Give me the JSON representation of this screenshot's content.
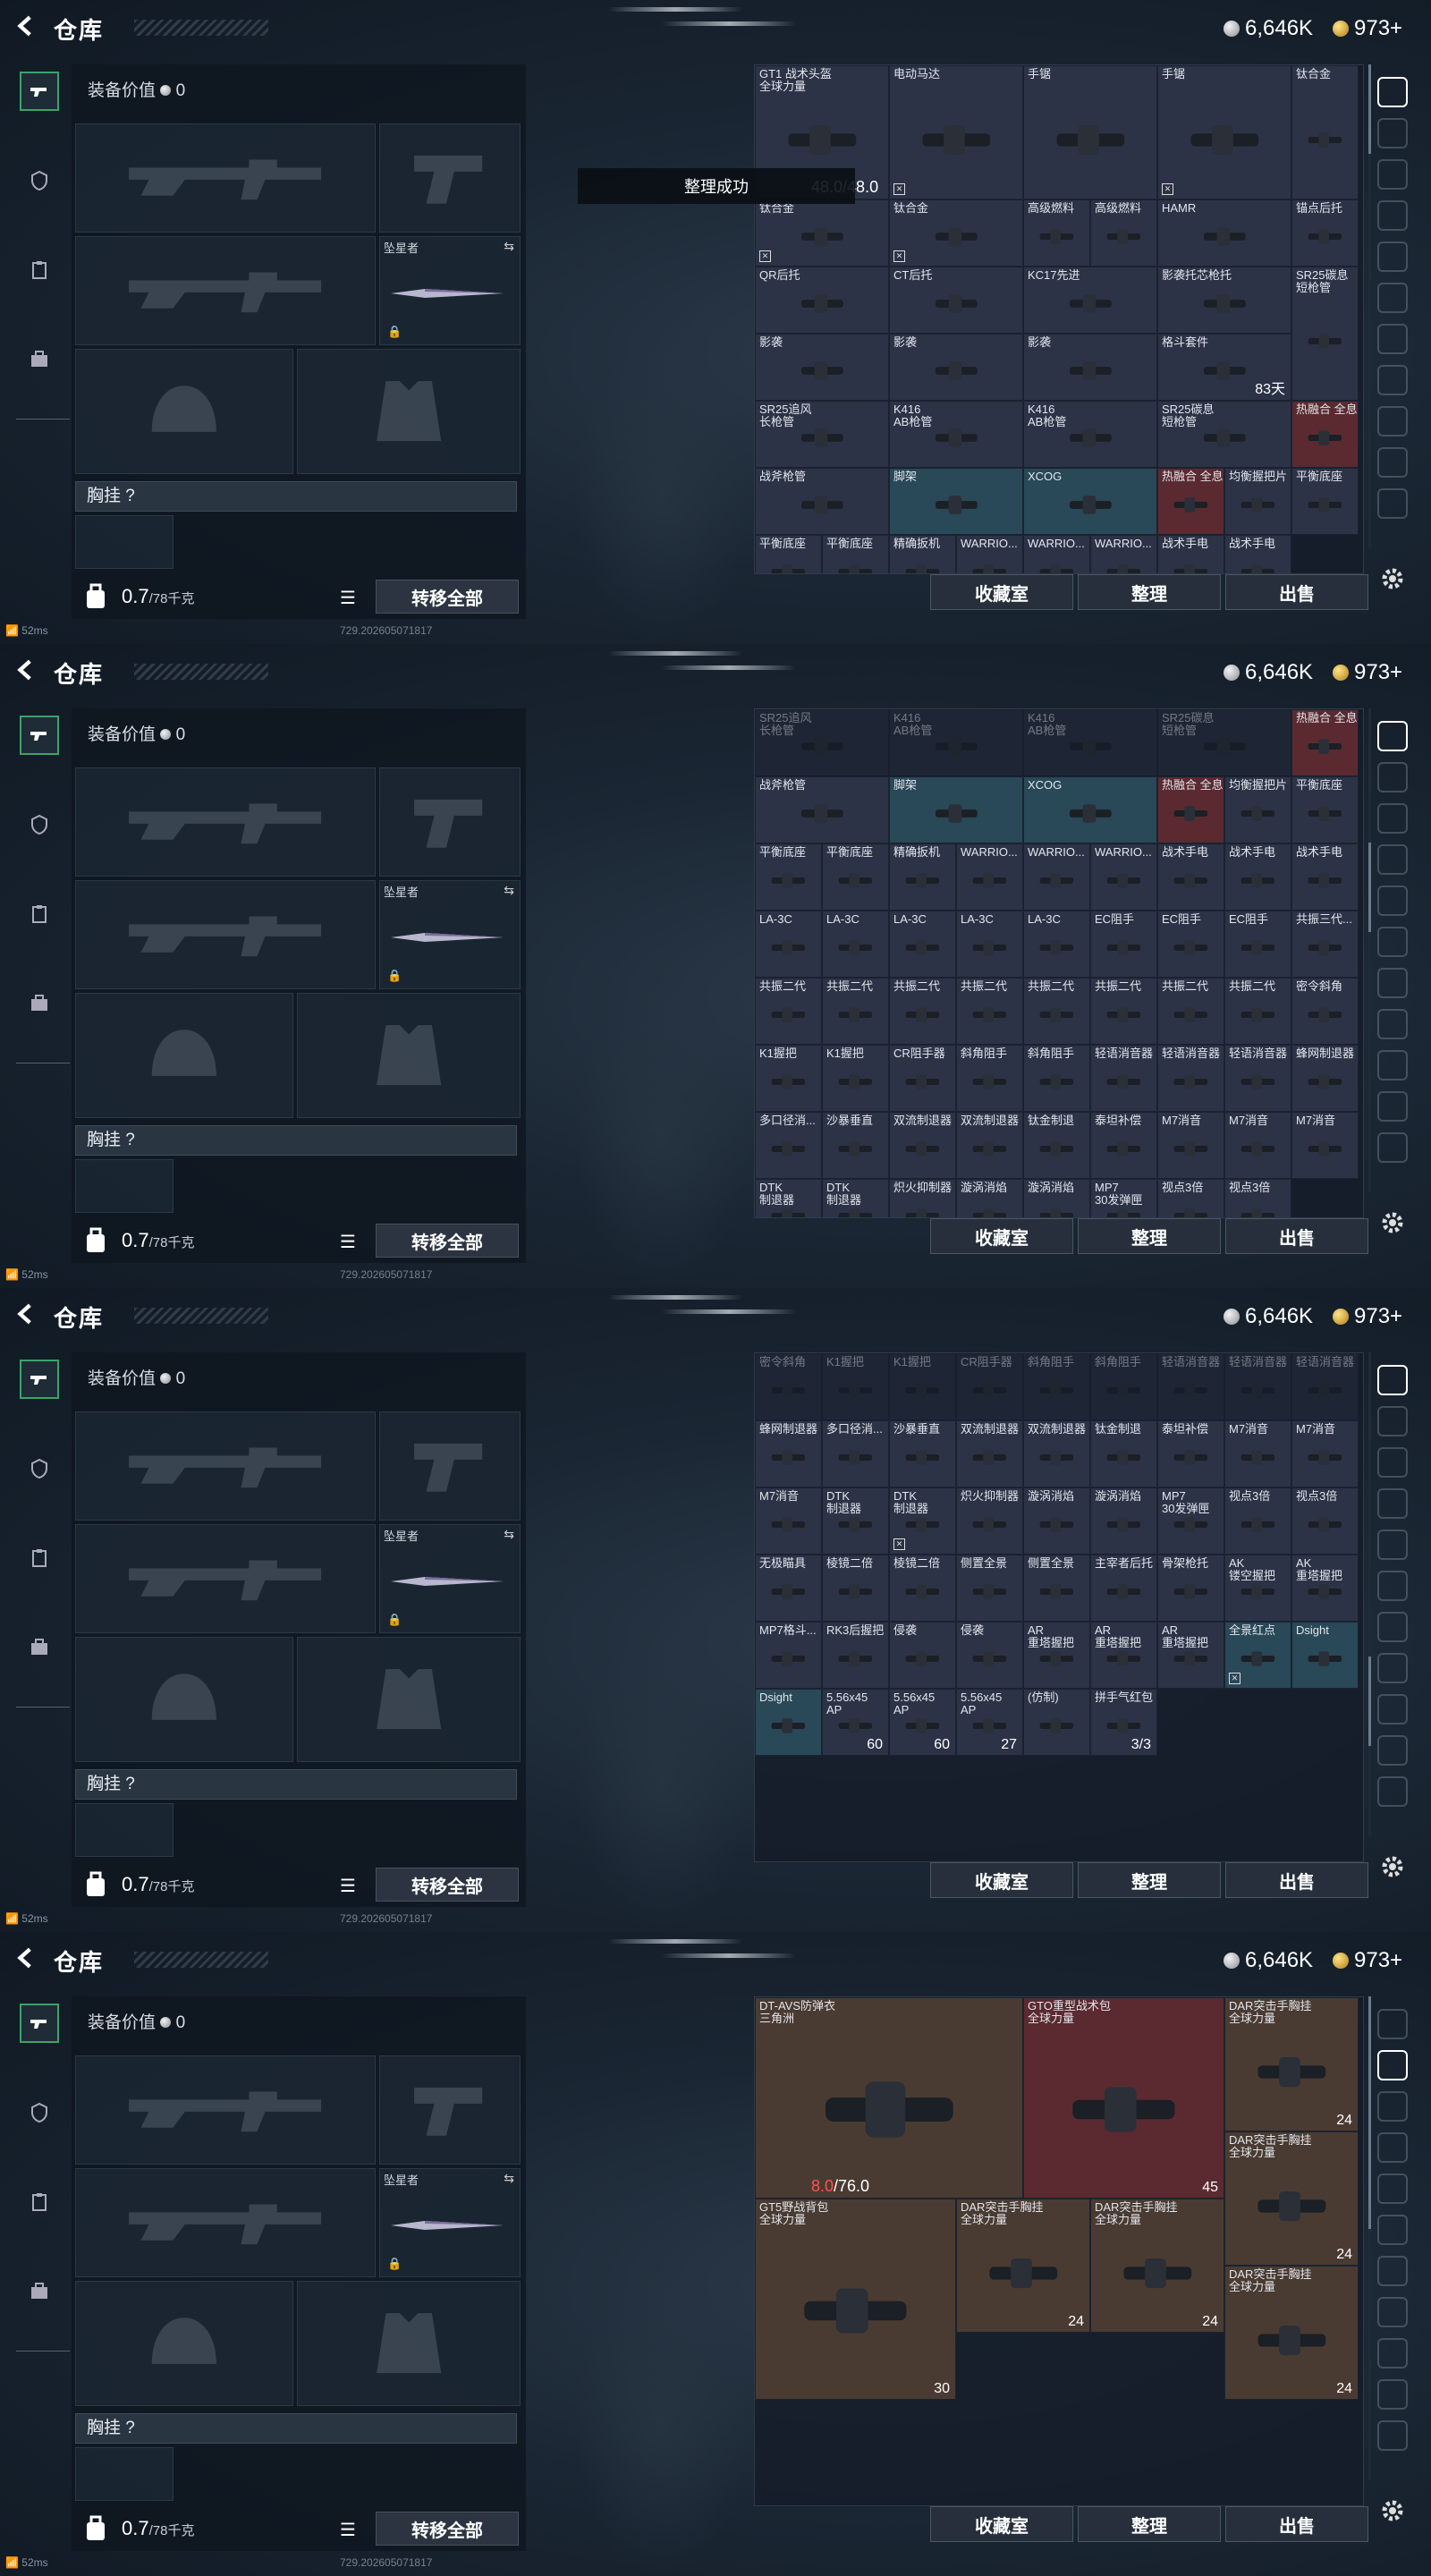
{
  "page": {
    "title": "仓库",
    "currency_silver": "6,646K",
    "currency_gold": "973+",
    "equip_value_label": "装备价值",
    "equip_value": "0",
    "knife_label": "坠星者",
    "chest_label": "胸挂 ?",
    "weight_value": "0.7",
    "weight_max": "/78千克",
    "transfer_all": "转移全部",
    "btn_collection": "收藏室",
    "btn_sort": "整理",
    "btn_sell": "出售",
    "ping": "52ms",
    "build_id": "729.202605071817",
    "toast": "整理成功"
  },
  "screens": [
    {
      "items": [
        {
          "name": "GT1 战术头盔\n全球力量",
          "w": 2,
          "h": 2,
          "dur": "48.0",
          "durmax": "/48.0"
        },
        {
          "name": "电动马达",
          "w": 2,
          "h": 2,
          "mark": 1
        },
        {
          "name": "手锯",
          "w": 2,
          "h": 2
        },
        {
          "name": "手锯",
          "w": 2,
          "h": 2,
          "mark": 1
        },
        {
          "name": "钛合金",
          "w": 1,
          "h": 2
        },
        {
          "name": "钛合金",
          "w": 2,
          "h": 1,
          "mark": 1
        },
        {
          "name": "钛合金",
          "w": 2,
          "h": 1,
          "mark": 1
        },
        {
          "name": "高级燃料"
        },
        {
          "name": "高级燃料"
        },
        {
          "name": "HAMR",
          "w": 2
        },
        {
          "name": "锚点后托"
        },
        {
          "name": "QR后托",
          "w": 2
        },
        {
          "name": "CT后托",
          "w": 2
        },
        {
          "name": "KC17先进",
          "w": 2
        },
        {
          "name": "影袭托芯枪托",
          "w": 2
        },
        {
          "name": "影袭",
          "w": 2
        },
        {
          "name": "影袭",
          "w": 2
        },
        {
          "name": "影袭",
          "w": 2
        },
        {
          "name": "格斗套件",
          "w": 2,
          "cnt": "83天"
        },
        {
          "name": "SR25碳息\n短枪管",
          "h": 2
        },
        {
          "name": "SR25追风\n长枪管",
          "w": 2
        },
        {
          "name": "K416\nAB枪管",
          "w": 2
        },
        {
          "name": "K416\nAB枪管",
          "w": 2
        },
        {
          "name": "SR25碳息\n短枪管",
          "w": 2
        },
        {
          "name": "战斧枪管",
          "w": 2
        },
        {
          "name": "脚架",
          "w": 2,
          "c": "blue"
        },
        {
          "name": "XCOG",
          "w": 2,
          "c": "blue"
        },
        {
          "name": "热融合 全息",
          "c": "red"
        },
        {
          "name": "热融合 全息",
          "c": "red"
        },
        {
          "name": "均衡握把片"
        },
        {
          "name": "平衡底座"
        },
        {
          "name": "平衡底座"
        },
        {
          "name": "平衡底座"
        },
        {
          "name": "精确扳机"
        },
        {
          "name": "WARRIO..."
        },
        {
          "name": "WARRIO..."
        },
        {
          "name": "WARRIO..."
        },
        {
          "name": "战术手电"
        },
        {
          "name": "战术手电"
        }
      ]
    },
    {
      "items": [
        {
          "name": "SR25追风\n长枪管",
          "w": 2,
          "f": 1
        },
        {
          "name": "K416\nAB枪管",
          "w": 2,
          "f": 1
        },
        {
          "name": "K416\nAB枪管",
          "w": 2,
          "f": 1
        },
        {
          "name": "SR25碳息\n短枪管",
          "w": 2,
          "f": 1
        },
        {
          "name": "战斧枪管",
          "w": 2
        },
        {
          "name": "脚架",
          "w": 2,
          "c": "blue"
        },
        {
          "name": "XCOG",
          "w": 2,
          "c": "blue"
        },
        {
          "name": "热融合 全息",
          "c": "red"
        },
        {
          "name": "热融合 全息",
          "c": "red"
        },
        {
          "name": "均衡握把片"
        },
        {
          "name": "平衡底座"
        },
        {
          "name": "平衡底座"
        },
        {
          "name": "平衡底座"
        },
        {
          "name": "精确扳机"
        },
        {
          "name": "WARRIO..."
        },
        {
          "name": "WARRIO..."
        },
        {
          "name": "WARRIO..."
        },
        {
          "name": "战术手电"
        },
        {
          "name": "战术手电"
        },
        {
          "name": "战术手电"
        },
        {
          "name": "LA-3C"
        },
        {
          "name": "LA-3C"
        },
        {
          "name": "LA-3C"
        },
        {
          "name": "LA-3C"
        },
        {
          "name": "LA-3C"
        },
        {
          "name": "EC阻手"
        },
        {
          "name": "EC阻手"
        },
        {
          "name": "EC阻手"
        },
        {
          "name": "共振三代..."
        },
        {
          "name": "共振二代"
        },
        {
          "name": "共振二代"
        },
        {
          "name": "共振二代"
        },
        {
          "name": "共振二代"
        },
        {
          "name": "共振二代"
        },
        {
          "name": "共振二代"
        },
        {
          "name": "共振二代"
        },
        {
          "name": "共振二代"
        },
        {
          "name": "密令斜角"
        },
        {
          "name": "K1握把"
        },
        {
          "name": "K1握把"
        },
        {
          "name": "CR阻手器"
        },
        {
          "name": "斜角阻手"
        },
        {
          "name": "斜角阻手"
        },
        {
          "name": "轻语消音器"
        },
        {
          "name": "轻语消音器"
        },
        {
          "name": "轻语消音器"
        },
        {
          "name": "蜂网制退器"
        },
        {
          "name": "多口径消..."
        },
        {
          "name": "沙暴垂直"
        },
        {
          "name": "双流制退器"
        },
        {
          "name": "双流制退器"
        },
        {
          "name": "钛金制退"
        },
        {
          "name": "泰坦补偿"
        },
        {
          "name": "M7消音"
        },
        {
          "name": "M7消音"
        },
        {
          "name": "M7消音"
        },
        {
          "name": "DTK\n制退器"
        },
        {
          "name": "DTK\n制退器"
        },
        {
          "name": "炽火抑制器"
        },
        {
          "name": "漩涡消焰"
        },
        {
          "name": "漩涡消焰"
        },
        {
          "name": "MP7\n30发弹匣"
        },
        {
          "name": "视点3倍"
        },
        {
          "name": "视点3倍"
        }
      ]
    },
    {
      "items": [
        {
          "name": "密令斜角",
          "f": 1
        },
        {
          "name": "K1握把",
          "f": 1
        },
        {
          "name": "K1握把",
          "f": 1
        },
        {
          "name": "CR阻手器",
          "f": 1
        },
        {
          "name": "斜角阻手",
          "f": 1
        },
        {
          "name": "斜角阻手",
          "f": 1
        },
        {
          "name": "轻语消音器",
          "f": 1
        },
        {
          "name": "轻语消音器",
          "f": 1
        },
        {
          "name": "轻语消音器",
          "f": 1
        },
        {
          "name": "蜂网制退器"
        },
        {
          "name": "多口径消..."
        },
        {
          "name": "沙暴垂直"
        },
        {
          "name": "双流制退器"
        },
        {
          "name": "双流制退器"
        },
        {
          "name": "钛金制退"
        },
        {
          "name": "泰坦补偿"
        },
        {
          "name": "M7消音"
        },
        {
          "name": "M7消音"
        },
        {
          "name": "M7消音"
        },
        {
          "name": "DTK\n制退器"
        },
        {
          "name": "DTK\n制退器",
          "mark": 1
        },
        {
          "name": "炽火抑制器"
        },
        {
          "name": "漩涡消焰"
        },
        {
          "name": "漩涡消焰"
        },
        {
          "name": "MP7\n30发弹匣"
        },
        {
          "name": "视点3倍"
        },
        {
          "name": "视点3倍"
        },
        {
          "name": "无极瞄具"
        },
        {
          "name": "棱镜二倍"
        },
        {
          "name": "棱镜二倍"
        },
        {
          "name": "侧置全景"
        },
        {
          "name": "侧置全景"
        },
        {
          "name": "主宰者后托"
        },
        {
          "name": "骨架枪托"
        },
        {
          "name": "AK\n镂空握把"
        },
        {
          "name": "AK\n重塔握把"
        },
        {
          "name": "MP7格斗..."
        },
        {
          "name": "RK3后握把"
        },
        {
          "name": "侵袭"
        },
        {
          "name": "侵袭"
        },
        {
          "name": "AR\n重塔握把"
        },
        {
          "name": "AR\n重塔握把"
        },
        {
          "name": "AR\n重塔握把"
        },
        {
          "name": "全景红点",
          "c": "blue",
          "mark": 1
        },
        {
          "name": "Dsight",
          "c": "blue"
        },
        {
          "name": "Dsight",
          "c": "blue"
        },
        {
          "name": "5.56x45\nAP",
          "cnt": "60"
        },
        {
          "name": "5.56x45\nAP",
          "cnt": "60"
        },
        {
          "name": "5.56x45\nAP",
          "cnt": "27"
        },
        {
          "name": "(仿制)"
        },
        {
          "name": "拼手气红包",
          "cnt": "3/3"
        }
      ]
    },
    {
      "items": [
        {
          "name": "DT-AVS防弹衣\n三角洲",
          "w": 4,
          "h": 3,
          "c": "brown",
          "dur": "8.0",
          "durmax": "/76.0",
          "durred": 1
        },
        {
          "name": "GTO重型战术包\n全球力量",
          "w": 3,
          "h": 3,
          "c": "red",
          "cnt": "45"
        },
        {
          "name": "DAR突击手胸挂\n全球力量",
          "w": 2,
          "h": 2,
          "c": "brown",
          "cnt": "24"
        },
        {
          "name": "DAR突击手胸挂\n全球力量",
          "w": 2,
          "h": 2,
          "c": "brown",
          "cnt": "24"
        },
        {
          "name": "GT5野战背包\n全球力量",
          "w": 3,
          "h": 3,
          "c": "brown",
          "cnt": "30"
        },
        {
          "name": "DAR突击手胸挂\n全球力量",
          "w": 2,
          "h": 2,
          "c": "brown",
          "cnt": "24"
        },
        {
          "name": "DAR突击手胸挂\n全球力量",
          "w": 2,
          "h": 2,
          "c": "brown",
          "cnt": "24"
        },
        {
          "name": "DAR突击手胸挂\n全球力量",
          "w": 2,
          "h": 2,
          "c": "brown",
          "cnt": "24"
        }
      ]
    }
  ]
}
